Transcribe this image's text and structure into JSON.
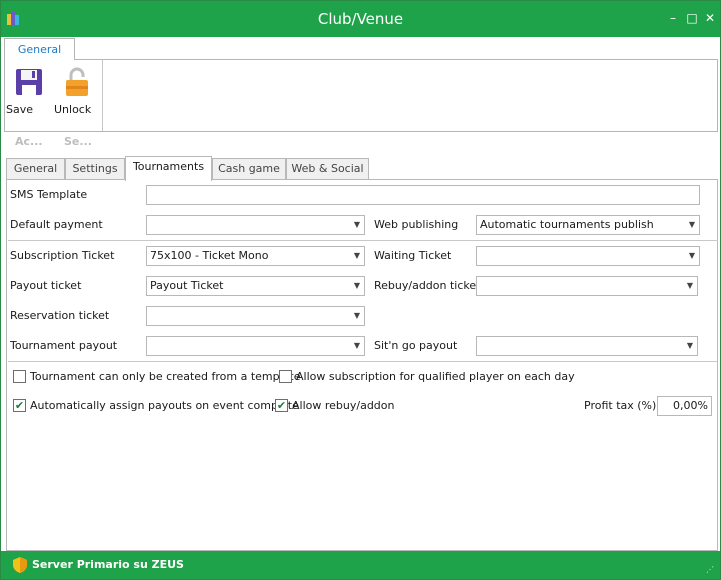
{
  "window": {
    "title": "Club/Venue",
    "minimize_label": "–",
    "maximize_label": "□",
    "close_label": "✕"
  },
  "ribbon": {
    "tab_label": "General",
    "buttons": [
      {
        "label": "Save",
        "icon": "floppy-disk-icon"
      },
      {
        "label": "Unlock",
        "icon": "padlock-icon"
      }
    ],
    "sections": [
      "Ac...",
      "Se..."
    ]
  },
  "tabs": [
    "General",
    "Settings",
    "Tournaments",
    "Cash game",
    "Web & Social"
  ],
  "active_tab": "Tournaments",
  "form": {
    "sms_template": {
      "label": "SMS Template",
      "value": ""
    },
    "default_payment": {
      "label": "Default payment",
      "value": ""
    },
    "web_publishing": {
      "label": "Web publishing",
      "value": "Automatic tournaments publish"
    },
    "subscription_ticket": {
      "label": "Subscription Ticket",
      "value": "75x100 - Ticket Mono"
    },
    "waiting_ticket": {
      "label": "Waiting Ticket",
      "value": ""
    },
    "payout_ticket": {
      "label": "Payout ticket",
      "value": "Payout Ticket"
    },
    "rebuy_addon_ticket": {
      "label": "Rebuy/addon ticket",
      "value": ""
    },
    "reservation_ticket": {
      "label": "Reservation ticket",
      "value": ""
    },
    "tournament_payout": {
      "label": "Tournament payout",
      "value": ""
    },
    "sitngo_payout": {
      "label": "Sit'n go payout",
      "value": ""
    }
  },
  "checkboxes": {
    "template_only": {
      "label": "Tournament can only be created from a template",
      "checked": false
    },
    "allow_subscription": {
      "label": "Allow subscription for qualified player on each day",
      "checked": false
    },
    "auto_assign_payouts": {
      "label": "Automatically assign payouts on event complete",
      "checked": true
    },
    "allow_rebuy": {
      "label": "Allow rebuy/addon",
      "checked": true
    }
  },
  "profit_tax": {
    "label": "Profit tax (%)",
    "value": "0,00%"
  },
  "check_mark": "✔",
  "dropdown_arrow": "▼",
  "statusbar": {
    "text": "Server Primario su ZEUS",
    "icon": "shield-icon"
  },
  "colors": {
    "accent": "#1fa34a",
    "tab_text": "#1f78c8"
  }
}
